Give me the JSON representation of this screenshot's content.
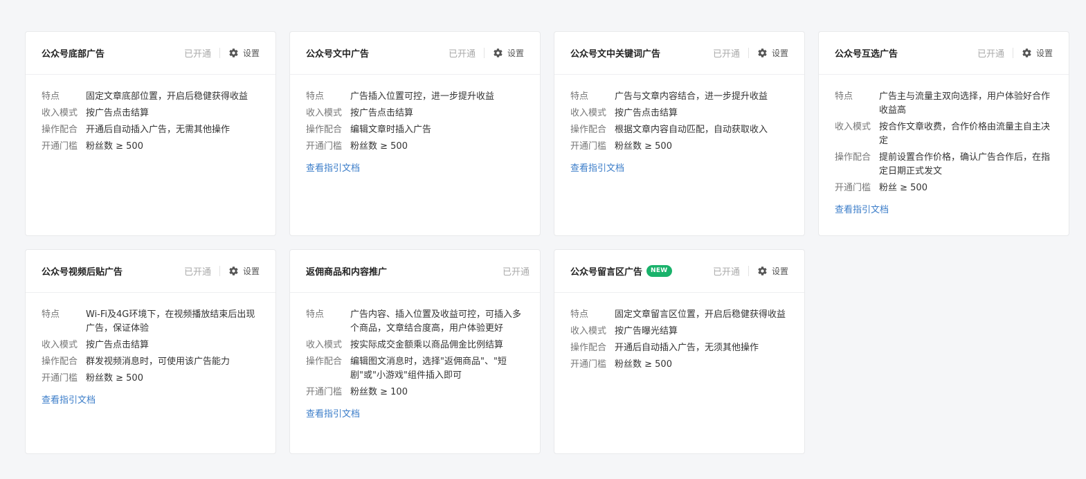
{
  "labels": {
    "feature": "特点",
    "income": "收入模式",
    "operation": "操作配合",
    "threshold": "开通门槛"
  },
  "status_text": "已开通",
  "settings_label": "设置",
  "doc_link": "查看指引文档",
  "new_badge": "NEW",
  "cards": [
    {
      "title": "公众号底部广告",
      "feature": "固定文章底部位置，开启后稳健获得收益",
      "income": "按广告点击结算",
      "operation": "开通后自动插入广告，无需其他操作",
      "threshold": "粉丝数 ≥ 500"
    },
    {
      "title": "公众号文中广告",
      "feature": "广告插入位置可控，进一步提升收益",
      "income": "按广告点击结算",
      "operation": "编辑文章时插入广告",
      "threshold": "粉丝数 ≥ 500"
    },
    {
      "title": "公众号文中关键词广告",
      "feature": "广告与文章内容结合，进一步提升收益",
      "income": "按广告点击结算",
      "operation": "根据文章内容自动匹配，自动获取收入",
      "threshold": "粉丝数 ≥ 500"
    },
    {
      "title": "公众号互选广告",
      "feature": "广告主与流量主双向选择，用户体验好合作收益高",
      "income": "按合作文章收费，合作价格由流量主自主决定",
      "operation": "提前设置合作价格，确认广告合作后，在指定日期正式发文",
      "threshold": "粉丝 ≥ 500"
    },
    {
      "title": "公众号视频后贴广告",
      "feature": "Wi-Fi及4G环境下，在视频播放结束后出现广告，保证体验",
      "income": "按广告点击结算",
      "operation": "群发视频消息时，可使用该广告能力",
      "threshold": "粉丝数 ≥ 500"
    },
    {
      "title": "返佣商品和内容推广",
      "feature": "广告内容、插入位置及收益可控，可插入多个商品，文章结合度高，用户体验更好",
      "income": "按实际成交金额乘以商品佣金比例结算",
      "operation": "编辑图文消息时，选择\"返佣商品\"、\"短剧\"或\"小游戏\"组件插入即可",
      "threshold": "粉丝数 ≥ 100"
    },
    {
      "title": "公众号留言区广告",
      "feature": "固定文章留言区位置，开启后稳健获得收益",
      "income": "按广告曝光结算",
      "operation": "开通后自动插入广告，无须其他操作",
      "threshold": "粉丝数 ≥ 500"
    }
  ]
}
